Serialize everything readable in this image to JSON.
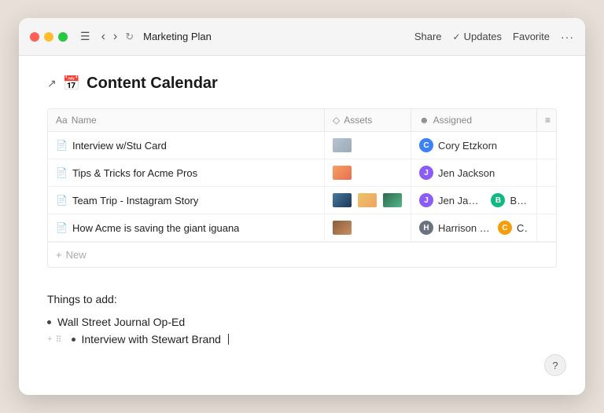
{
  "titlebar": {
    "title": "Marketing Plan",
    "share_label": "Share",
    "updates_label": "Updates",
    "favorite_label": "Favorite",
    "more_label": "···"
  },
  "page": {
    "title": "Content Calendar",
    "arrow_icon": "↗",
    "calendar_emoji": "📅"
  },
  "table": {
    "columns": [
      {
        "icon": "Aa",
        "label": "Name"
      },
      {
        "icon": "◇",
        "label": "Assets"
      },
      {
        "icon": "☻",
        "label": "Assigned"
      },
      {
        "icon": "≡",
        "label": ""
      }
    ],
    "rows": [
      {
        "name": "Interview w/Stu Card",
        "has_asset": false,
        "asset_style": "",
        "assignee": "Cory Etzkorn",
        "assignee_color": "av-blue",
        "assignee_initial": "C"
      },
      {
        "name": "Tips & Tricks for Acme Pros",
        "has_asset": true,
        "asset_style": "thumb-orange",
        "assignee": "Jen Jackson",
        "assignee_color": "av-purple",
        "assignee_initial": "J"
      },
      {
        "name": "Team Trip - Instagram Story",
        "has_asset": true,
        "asset_style": "thumb-blue",
        "assignee": "Jen Jackson  🧑 Beez",
        "assignee_color": "av-purple",
        "assignee_initial": "J",
        "extra_assignee": true,
        "extra_initial": "B",
        "extra_color": "av-green"
      },
      {
        "name": "How Acme is saving the giant iguana",
        "has_asset": true,
        "asset_style": "thumb-brown",
        "assignee": "Harrison Medoff",
        "assignee_color": "av-gray",
        "assignee_initial": "H",
        "extra_assignee": true,
        "extra_initial": "C",
        "extra_color": "av-orange"
      }
    ],
    "new_row_label": "New"
  },
  "notes": {
    "title": "Things to add:",
    "items": [
      {
        "text": "Wall Street Journal Op-Ed",
        "active": false
      },
      {
        "text": "Interview with Stewart Brand",
        "active": true
      }
    ]
  },
  "help": {
    "label": "?"
  }
}
